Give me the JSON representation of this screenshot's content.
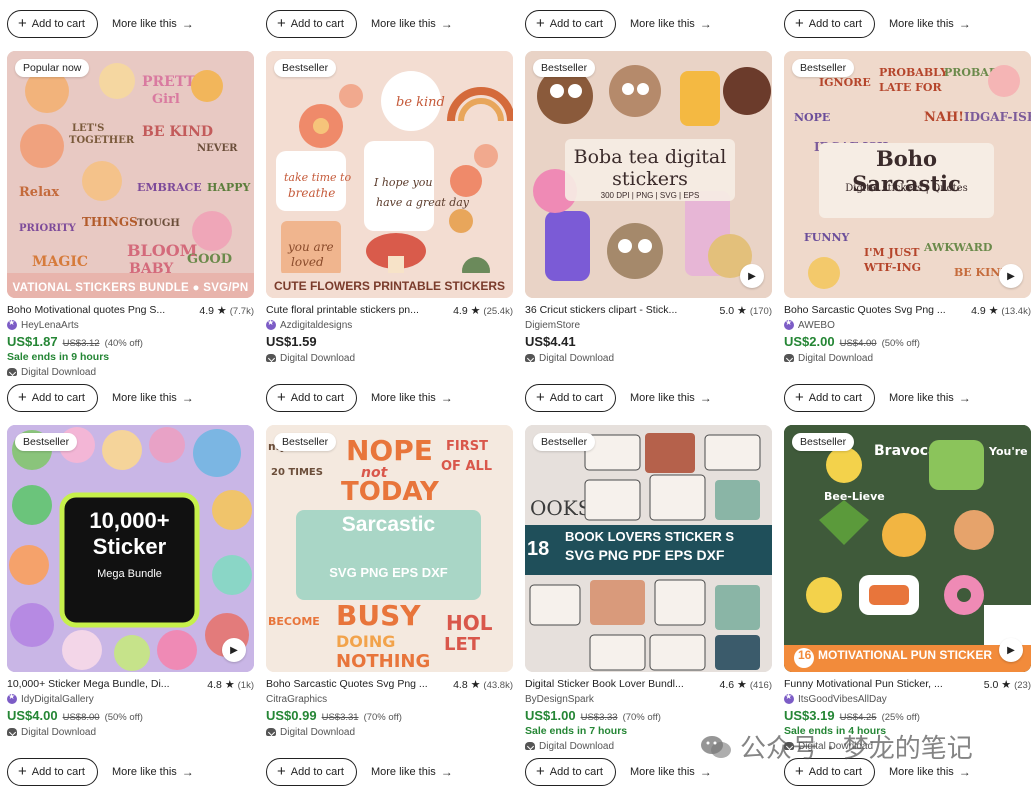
{
  "common": {
    "add_to_cart": "Add to cart",
    "more_like_this": "More like this",
    "digital_download": "Digital Download"
  },
  "rows": [
    {
      "cards": [
        {
          "badge": "Popular now",
          "title": "Boho Motivational quotes Png S...",
          "rating": "4.9",
          "reviews": "(7.7k)",
          "shop": "HeyLenaArts",
          "star_seller": true,
          "price": "US$1.87",
          "original_price": "US$3.12",
          "discount": "(40% off)",
          "sale_ends": "Sale ends in 9 hours",
          "thumb_text": "VATIONAL STICKERS BUNDLE ● SVG/PN",
          "video": false,
          "bg": "#e8c9c3"
        },
        {
          "badge": "Bestseller",
          "title": "Cute floral printable stickers pn...",
          "rating": "4.9",
          "reviews": "(25.4k)",
          "shop": "Azdigitaldesigns",
          "star_seller": true,
          "price": "US$1.59",
          "original_price": "",
          "discount": "",
          "sale_ends": "",
          "thumb_text": "CUTE FLOWERS PRINTABLE STICKERS",
          "video": false,
          "bg": "#f3ddd2"
        },
        {
          "badge": "Bestseller",
          "title": "36 Cricut stickers clipart - Stick...",
          "rating": "5.0",
          "reviews": "(170)",
          "shop": "DigiemStore",
          "star_seller": false,
          "price": "US$4.41",
          "original_price": "",
          "discount": "",
          "sale_ends": "",
          "thumb_text": "Boba tea digital stickers",
          "thumb_sub": "300 DPI | PNG | SVG | EPS",
          "video": true,
          "bg": "#e9d3c6"
        },
        {
          "badge": "Bestseller",
          "title": "Boho Sarcastic Quotes Svg Png ...",
          "rating": "4.9",
          "reviews": "(13.4k)",
          "shop": "AWEBO",
          "star_seller": true,
          "price": "US$2.00",
          "original_price": "US$4.00",
          "discount": "(50% off)",
          "sale_ends": "",
          "thumb_text": "Boho Sarcastic",
          "thumb_sub": "Digital stickers | Quotes",
          "video": true,
          "bg": "#efd9cb"
        }
      ]
    },
    {
      "cards": [
        {
          "badge": "Bestseller",
          "title": "10,000+ Sticker Mega Bundle, Di...",
          "rating": "4.8",
          "reviews": "(1k)",
          "shop": "IdyDigitalGallery",
          "star_seller": true,
          "price": "US$4.00",
          "original_price": "US$8.00",
          "discount": "(50% off)",
          "sale_ends": "",
          "thumb_text": "10,000+ Sticker",
          "thumb_sub": "Mega Bundle",
          "video": true,
          "bg": "#c9b6e6"
        },
        {
          "badge": "Bestseller",
          "title": "Boho Sarcastic Quotes Svg Png ...",
          "rating": "4.8",
          "reviews": "(43.8k)",
          "shop": "CitraGraphics",
          "star_seller": false,
          "price": "US$0.99",
          "original_price": "US$3.31",
          "discount": "(70% off)",
          "sale_ends": "",
          "thumb_text": "Sarcastic",
          "thumb_sub": "SVG PNG EPS DXF",
          "video": false,
          "bg": "#f4e9df"
        },
        {
          "badge": "Bestseller",
          "title": "Digital Sticker Book Lover Bundl...",
          "rating": "4.6",
          "reviews": "(416)",
          "shop": "ByDesignSpark",
          "star_seller": false,
          "price": "US$1.00",
          "original_price": "US$3.33",
          "discount": "(70% off)",
          "sale_ends": "Sale ends in 7 hours",
          "thumb_text": "BOOK LOVERS STICKER S",
          "thumb_sub": "SVG PNG PDF EPS DXF",
          "video": false,
          "bg": "#e6e0dc"
        },
        {
          "badge": "Bestseller",
          "title": "Funny Motivational Pun Sticker, ...",
          "rating": "5.0",
          "reviews": "(23)",
          "shop": "ItsGoodVibesAllDay",
          "star_seller": true,
          "price": "US$3.19",
          "original_price": "US$4.25",
          "discount": "(25% off)",
          "sale_ends": "Sale ends in 4 hours",
          "thumb_text": "MOTIVATIONAL PUN STICKER",
          "video": true,
          "bg": "#3f5a3a"
        }
      ]
    }
  ],
  "watermark": "公众号 · 梦龙的笔记",
  "colors": {
    "sale_green": "#258635",
    "star_seller_purple": "#7c5cc6"
  }
}
